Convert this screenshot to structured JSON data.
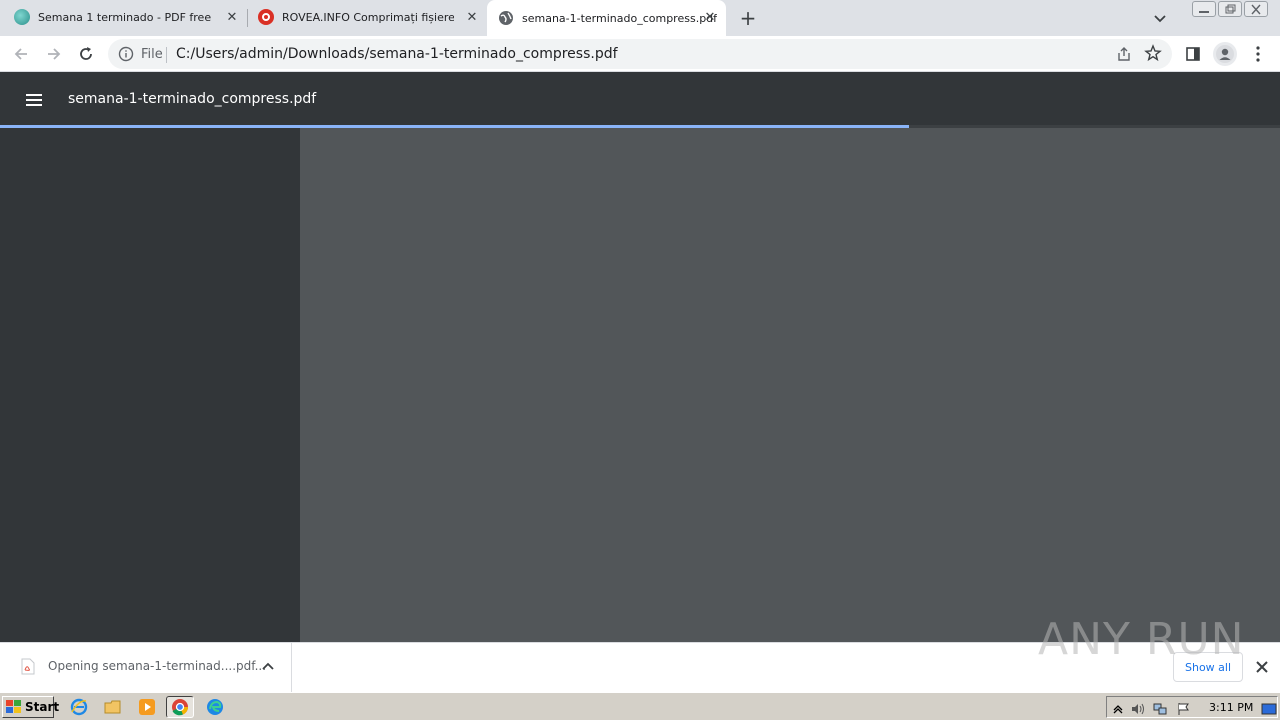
{
  "tabs": [
    {
      "title": "Semana 1 terminado - PDF free",
      "favicon_color": "#3ba8a2"
    },
    {
      "title": "ROVEA.INFO Comprimați fișiere PDF",
      "favicon_color": "#d93025"
    },
    {
      "title": "semana-1-terminado_compress.pdf",
      "favicon_color": "#5f6368"
    }
  ],
  "addressbar": {
    "scheme_label": "File",
    "url": "C:/Users/admin/Downloads/semana-1-terminado_compress.pdf"
  },
  "pdf": {
    "title": "semana-1-terminado_compress.pdf",
    "load_progress": 0.71
  },
  "download": {
    "label": "Opening semana-1-terminad....pdf...",
    "show_all": "Show all"
  },
  "watermark": "ANY RUN",
  "taskbar": {
    "start": "Start",
    "clock": "3:11 PM"
  },
  "colors": {
    "pdf_toolbar": "#323639",
    "pdf_viewer": "#525659",
    "progress": "#8ab4f8",
    "accent": "#1a73e8"
  }
}
